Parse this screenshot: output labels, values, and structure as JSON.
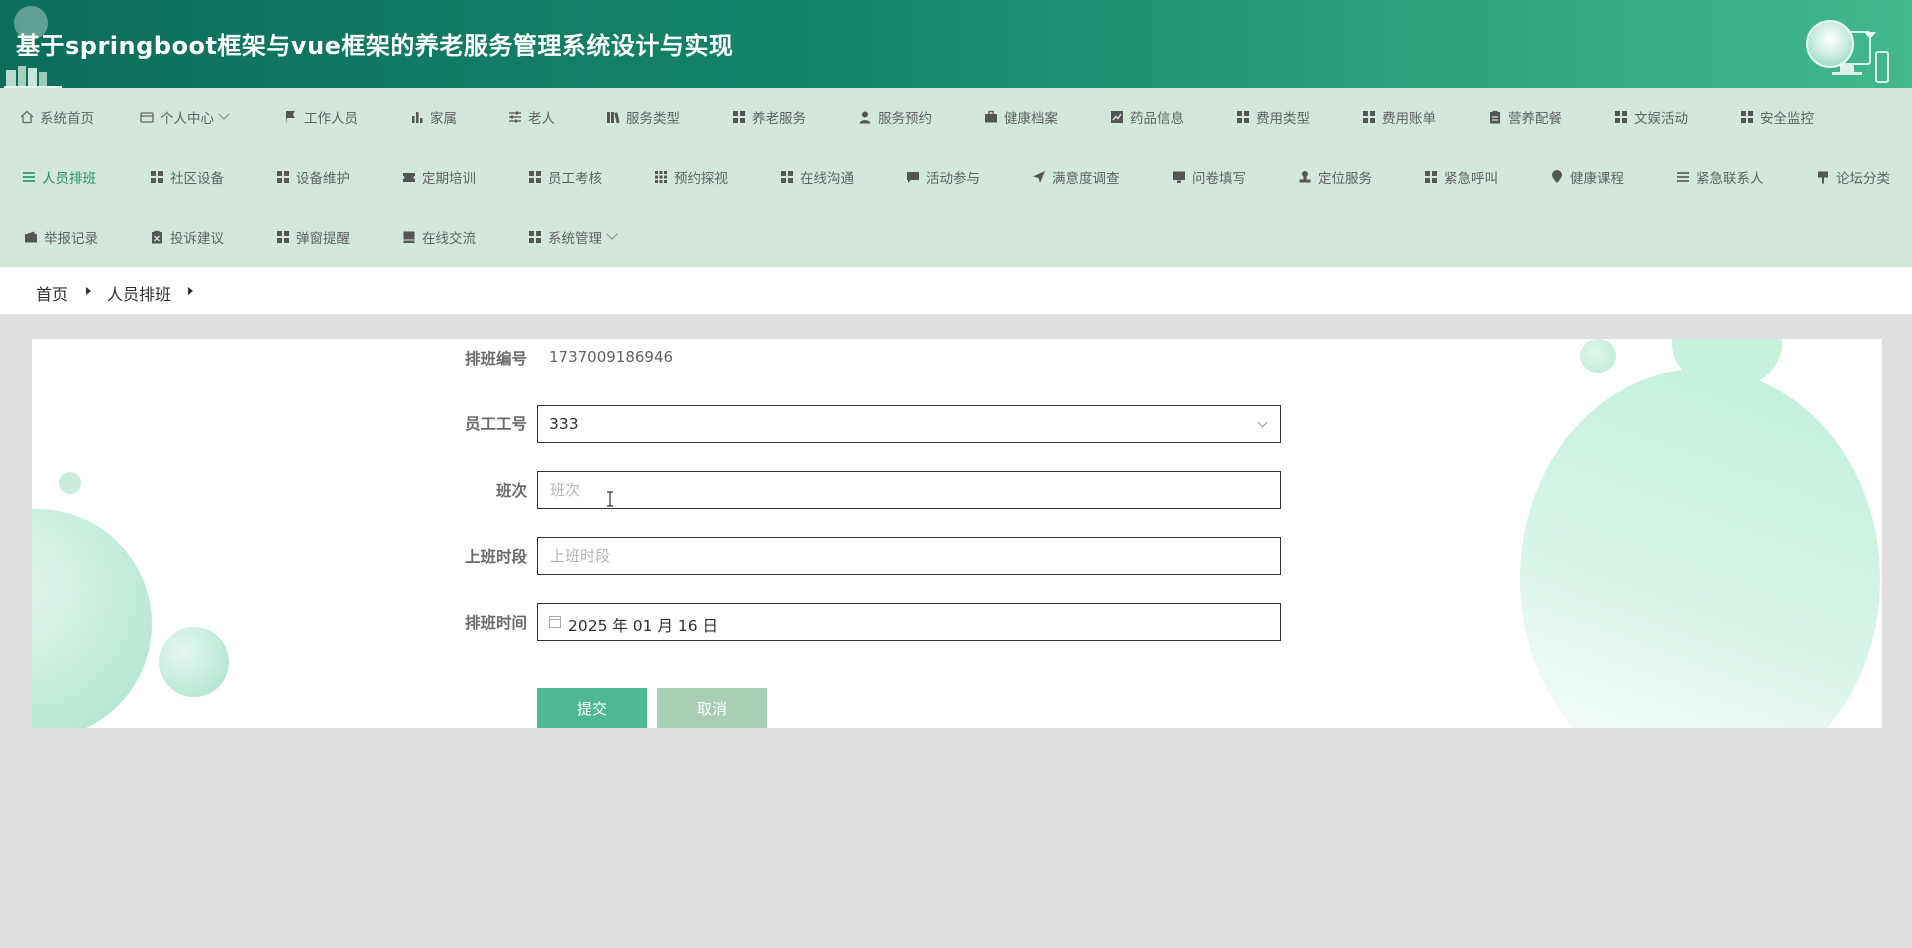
{
  "header": {
    "title": "基于springboot框架与vue框架的养老服务管理系统设计与实现"
  },
  "nav": {
    "items": [
      {
        "label": "系统首页",
        "icon": "home-icon"
      },
      {
        "label": "个人中心",
        "icon": "wallet-icon",
        "dropdown": true
      },
      {
        "label": "工作人员",
        "icon": "flag-icon"
      },
      {
        "label": "家属",
        "icon": "bar-chart-icon"
      },
      {
        "label": "老人",
        "icon": "sliders-icon"
      },
      {
        "label": "服务类型",
        "icon": "books-icon"
      },
      {
        "label": "养老服务",
        "icon": "grid-icon"
      },
      {
        "label": "服务预约",
        "icon": "user-icon"
      },
      {
        "label": "健康档案",
        "icon": "briefcase-icon"
      },
      {
        "label": "药品信息",
        "icon": "line-chart-icon"
      },
      {
        "label": "费用类型",
        "icon": "grid-icon"
      },
      {
        "label": "费用账单",
        "icon": "grid-icon"
      },
      {
        "label": "营养配餐",
        "icon": "clipboard-icon"
      },
      {
        "label": "文娱活动",
        "icon": "grid-icon"
      },
      {
        "label": "安全监控",
        "icon": "grid-icon"
      },
      {
        "label": "人员排班",
        "icon": "list-icon",
        "active": true
      },
      {
        "label": "社区设备",
        "icon": "grid-icon"
      },
      {
        "label": "设备维护",
        "icon": "grid-icon"
      },
      {
        "label": "定期培训",
        "icon": "ticket-icon"
      },
      {
        "label": "员工考核",
        "icon": "grid-icon"
      },
      {
        "label": "预约探视",
        "icon": "grid9-icon"
      },
      {
        "label": "在线沟通",
        "icon": "grid-icon"
      },
      {
        "label": "活动参与",
        "icon": "comment-icon"
      },
      {
        "label": "满意度调查",
        "icon": "send-icon"
      },
      {
        "label": "问卷填写",
        "icon": "monitor-icon"
      },
      {
        "label": "定位服务",
        "icon": "stamp-icon"
      },
      {
        "label": "紧急呼叫",
        "icon": "grid-icon"
      },
      {
        "label": "健康课程",
        "icon": "pin-icon"
      },
      {
        "label": "紧急联系人",
        "icon": "menu-icon"
      },
      {
        "label": "论坛分类",
        "icon": "signpost-icon"
      },
      {
        "label": "举报记录",
        "icon": "wallet-icon"
      },
      {
        "label": "投诉建议",
        "icon": "clipboard-x-icon"
      },
      {
        "label": "弹窗提醒",
        "icon": "grid-icon"
      },
      {
        "label": "在线交流",
        "icon": "tray-icon"
      },
      {
        "label": "系统管理",
        "icon": "grid-icon",
        "dropdown": true
      }
    ]
  },
  "breadcrumb": {
    "home": "首页",
    "current": "人员排班"
  },
  "form": {
    "schedule_no_label": "排班编号",
    "schedule_no_value": "1737009186946",
    "employee_no_label": "员工工号",
    "employee_no_value": "333",
    "shift_label": "班次",
    "shift_placeholder": "班次",
    "work_period_label": "上班时段",
    "work_period_placeholder": "上班时段",
    "schedule_time_label": "排班时间",
    "schedule_time_value": "2025 年 01 月 16 日",
    "submit_label": "提交",
    "cancel_label": "取消"
  },
  "colors": {
    "header_start": "#0c6e5a",
    "header_end": "#43b88d",
    "nav_bg": "#d3e8da",
    "active_nav": "#1d8f68",
    "submit_button": "#4db892",
    "cancel_button": "#a8cfb5",
    "page_bg": "#e0e0e0"
  }
}
